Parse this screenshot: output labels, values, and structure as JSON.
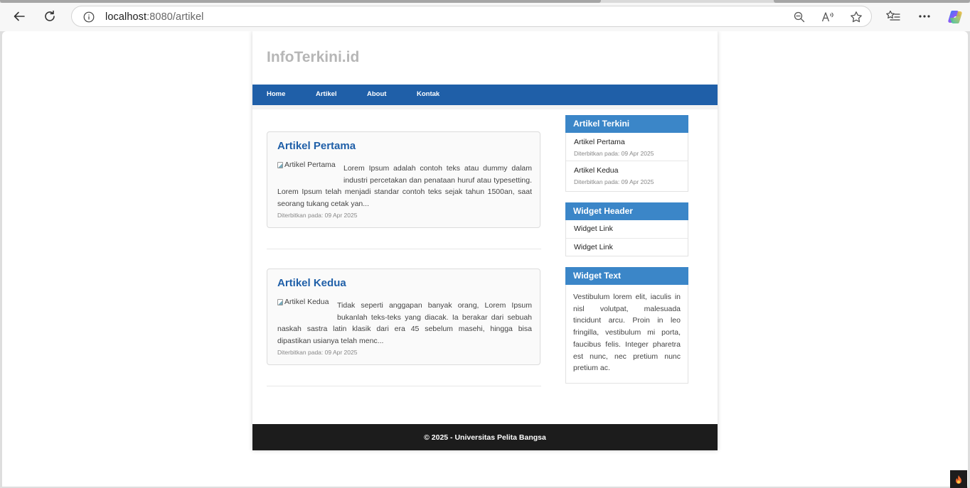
{
  "browser": {
    "url_host": "localhost",
    "url_path": ":8080/artikel",
    "icons": [
      "back-icon",
      "reload-icon",
      "site-info-icon",
      "zoom-out-icon",
      "read-aloud-icon",
      "favorite-star-icon",
      "favorites-list-icon",
      "more-icon",
      "copilot-icon"
    ]
  },
  "site": {
    "title": "InfoTerkini.id",
    "nav": [
      "Home",
      "Artikel",
      "About",
      "Kontak"
    ],
    "accent_color": "#1f5fa8"
  },
  "articles": [
    {
      "title": "Artikel Pertama",
      "image_alt": "Artikel Pertama",
      "excerpt": "Lorem Ipsum adalah contoh teks atau dummy dalam industri percetakan dan penataan huruf atau typesetting. Lorem Ipsum telah menjadi standar contoh teks sejak tahun 1500an, saat seorang tukang cetak yan...",
      "date": "Diterbitkan pada: 09 Apr 2025"
    },
    {
      "title": "Artikel Kedua",
      "image_alt": "Artikel Kedua",
      "excerpt": "Tidak seperti anggapan banyak orang, Lorem Ipsum bukanlah teks-teks yang diacak. Ia berakar dari sebuah naskah sastra latin klasik dari era 45 sebelum masehi, hingga bisa dipastikan usianya telah menc...",
      "date": "Diterbitkan pada: 09 Apr 2025"
    }
  ],
  "sidebar": {
    "recent": {
      "header": "Artikel Terkini",
      "items": [
        {
          "title": "Artikel Pertama",
          "date": "Diterbitkan pada: 09 Apr 2025"
        },
        {
          "title": "Artikel Kedua",
          "date": "Diterbitkan pada: 09 Apr 2025"
        }
      ]
    },
    "links": {
      "header": "Widget Header",
      "items": [
        "Widget Link",
        "Widget Link"
      ]
    },
    "text": {
      "header": "Widget Text",
      "body": "Vestibulum lorem elit, iaculis in nisl volutpat, malesuada tincidunt arcu. Proin in leo fringilla, vestibulum mi porta, faucibus felis. Integer pharetra est nunc, nec pretium nunc pretium ac."
    },
    "header_color": "#3b86c8"
  },
  "footer": {
    "text": "© 2025 - Universitas Pelita Bangsa"
  }
}
